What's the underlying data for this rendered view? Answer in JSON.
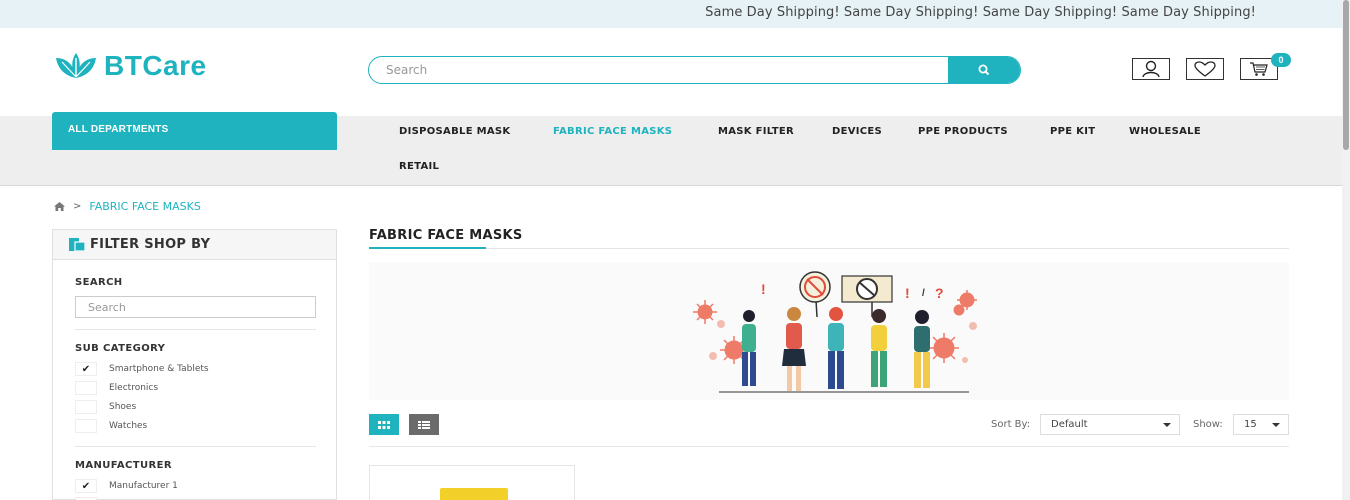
{
  "topbar": {
    "marquee": "Same Day Shipping! Same Day Shipping! Same Day Shipping! Same Day Shipping!"
  },
  "header": {
    "logo_text": "BTCare",
    "search_placeholder": "Search",
    "cart_count": "0"
  },
  "nav": {
    "all_departments": "ALL DEPARTMENTS",
    "items": [
      {
        "label": "DISPOSABLE MASK"
      },
      {
        "label": "FABRIC FACE MASKS"
      },
      {
        "label": "MASK FILTER"
      },
      {
        "label": "DEVICES"
      },
      {
        "label": "PPE PRODUCTS"
      },
      {
        "label": "PPE KIT"
      },
      {
        "label": "WHOLESALE"
      },
      {
        "label": "RETAIL"
      }
    ],
    "active": "FABRIC FACE MASKS"
  },
  "breadcrumb": {
    "separator": ">",
    "current": "FABRIC FACE MASKS"
  },
  "sidebar": {
    "title": "FILTER SHOP BY",
    "search_title": "SEARCH",
    "search_placeholder": "Search",
    "subcategory_title": "SUB CATEGORY",
    "subcategories": [
      {
        "label": "Smartphone & Tablets",
        "checked": true
      },
      {
        "label": "Electronics",
        "checked": false
      },
      {
        "label": "Shoes",
        "checked": false
      },
      {
        "label": "Watches",
        "checked": false
      }
    ],
    "manufacturer_title": "MANUFACTURER",
    "manufacturers": [
      {
        "label": "Manufacturer 1",
        "checked": true
      }
    ]
  },
  "content": {
    "title": "FABRIC FACE MASKS",
    "sort_label": "Sort By:",
    "sort_value": "Default",
    "show_label": "Show:",
    "show_value": "15"
  },
  "colors": {
    "accent": "#1fb3bf",
    "nav_bg": "#eeeeee",
    "topbar_bg": "#e6f2f6"
  },
  "icons": [
    "leaf-logo-icon",
    "search-icon",
    "user-icon",
    "heart-icon",
    "cart-icon",
    "home-icon",
    "filter-icon",
    "grid-view-icon",
    "list-view-icon",
    "chevron-down-icon",
    "check-icon"
  ]
}
